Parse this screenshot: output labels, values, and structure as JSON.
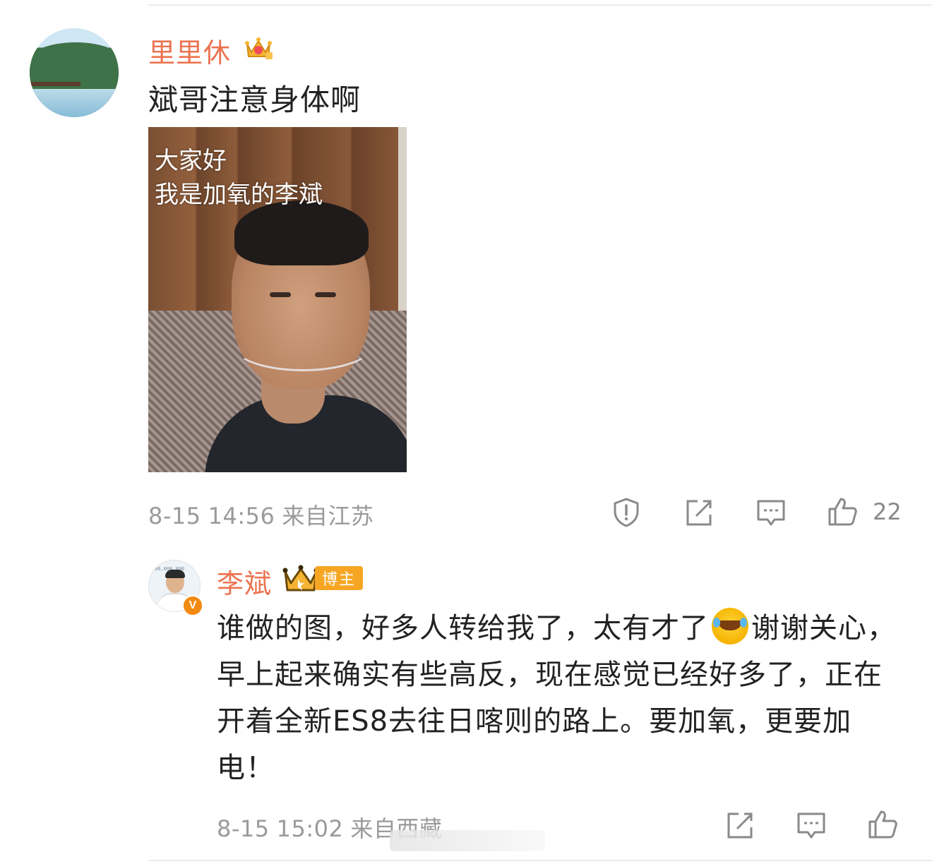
{
  "comment1": {
    "username": "里里休",
    "text": "斌哥注意身体啊",
    "image_text_line1": "大家好",
    "image_text_line2": "我是加氧的李斌",
    "date": "8-15",
    "time": "14:56",
    "location": "来自江苏",
    "like_count": "22",
    "username_color": "#eb7350"
  },
  "reply": {
    "username": "李斌",
    "author_tag": "博主",
    "text_part1": "谁做的图，好多人转给我了，太有才了",
    "text_part2": "谢谢关心，早上起来确实有些高反，现在感觉已经好多了，正在开着全新ES8去往日喀则的路上。要加氧，更要加电！",
    "emoji": "laughing-crying-emoji",
    "date": "8-15",
    "time": "15:02",
    "location": "来自西藏"
  },
  "icons": [
    "report-icon",
    "share-icon",
    "comment-icon",
    "like-icon"
  ]
}
